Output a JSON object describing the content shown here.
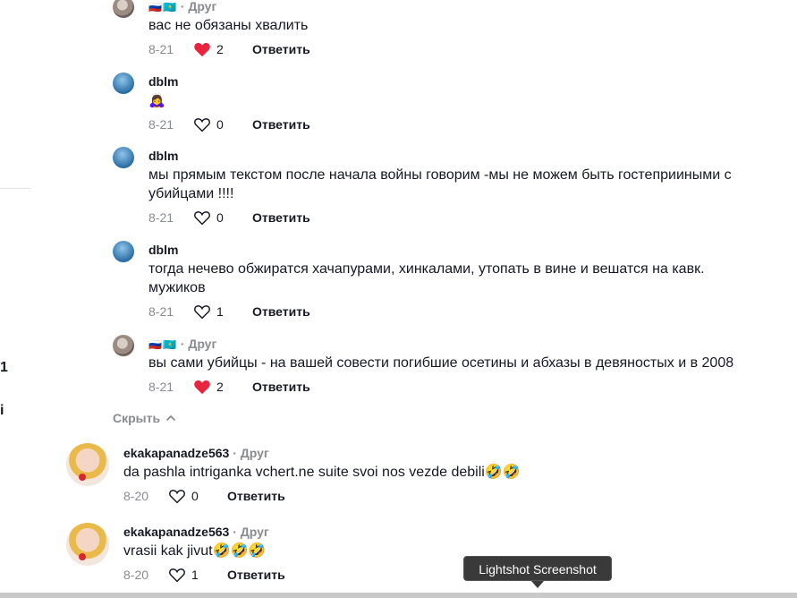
{
  "reply_label": "Ответить",
  "collapse_label": "Скрыть",
  "tooltip": "Lightshot Screenshot",
  "left_fragments": [
    "1",
    "i"
  ],
  "comments": [
    {
      "user": "🇷🇺🇰🇿",
      "tag": "Друг",
      "text": "вас не обязаны хвалить",
      "date": "8-21",
      "likes": "2",
      "liked": true
    },
    {
      "user": "dblm",
      "tag": "",
      "text": "🙇‍♀️",
      "date": "8-21",
      "likes": "0",
      "liked": false
    },
    {
      "user": "dblm",
      "tag": "",
      "text": "мы прямым текстом после начала войны говорим -мы не можем быть гостеприиными с убийцами !!!!",
      "date": "8-21",
      "likes": "0",
      "liked": false
    },
    {
      "user": "dblm",
      "tag": "",
      "text": "тогда нечево обжиратся хачапурами, хинкалами, утопать в вине и вешатся на кавк. мужиков",
      "date": "8-21",
      "likes": "1",
      "liked": false
    },
    {
      "user": "🇷🇺🇰🇿",
      "tag": "Друг",
      "text": "вы сами убийцы - на вашей совести погибшие осетины и абхазы в девяностых и в 2008",
      "date": "8-21",
      "likes": "2",
      "liked": true
    },
    {
      "user": "ekakapanadze563",
      "tag": "Друг",
      "text": "da pashla intriganka vchert.ne suite svoi nos vezde debili🤣🤣",
      "date": "8-20",
      "likes": "0",
      "liked": false
    },
    {
      "user": "ekakapanadze563",
      "tag": "Друг",
      "text": "vrasii kak jivut🤣🤣🤣",
      "date": "8-20",
      "likes": "1",
      "liked": false
    }
  ],
  "colors": {
    "like_red": "#fe2c55",
    "muted": "#8a8b91",
    "text": "#161823"
  },
  "icons": [
    "heart-icon",
    "chevron-up-icon"
  ]
}
